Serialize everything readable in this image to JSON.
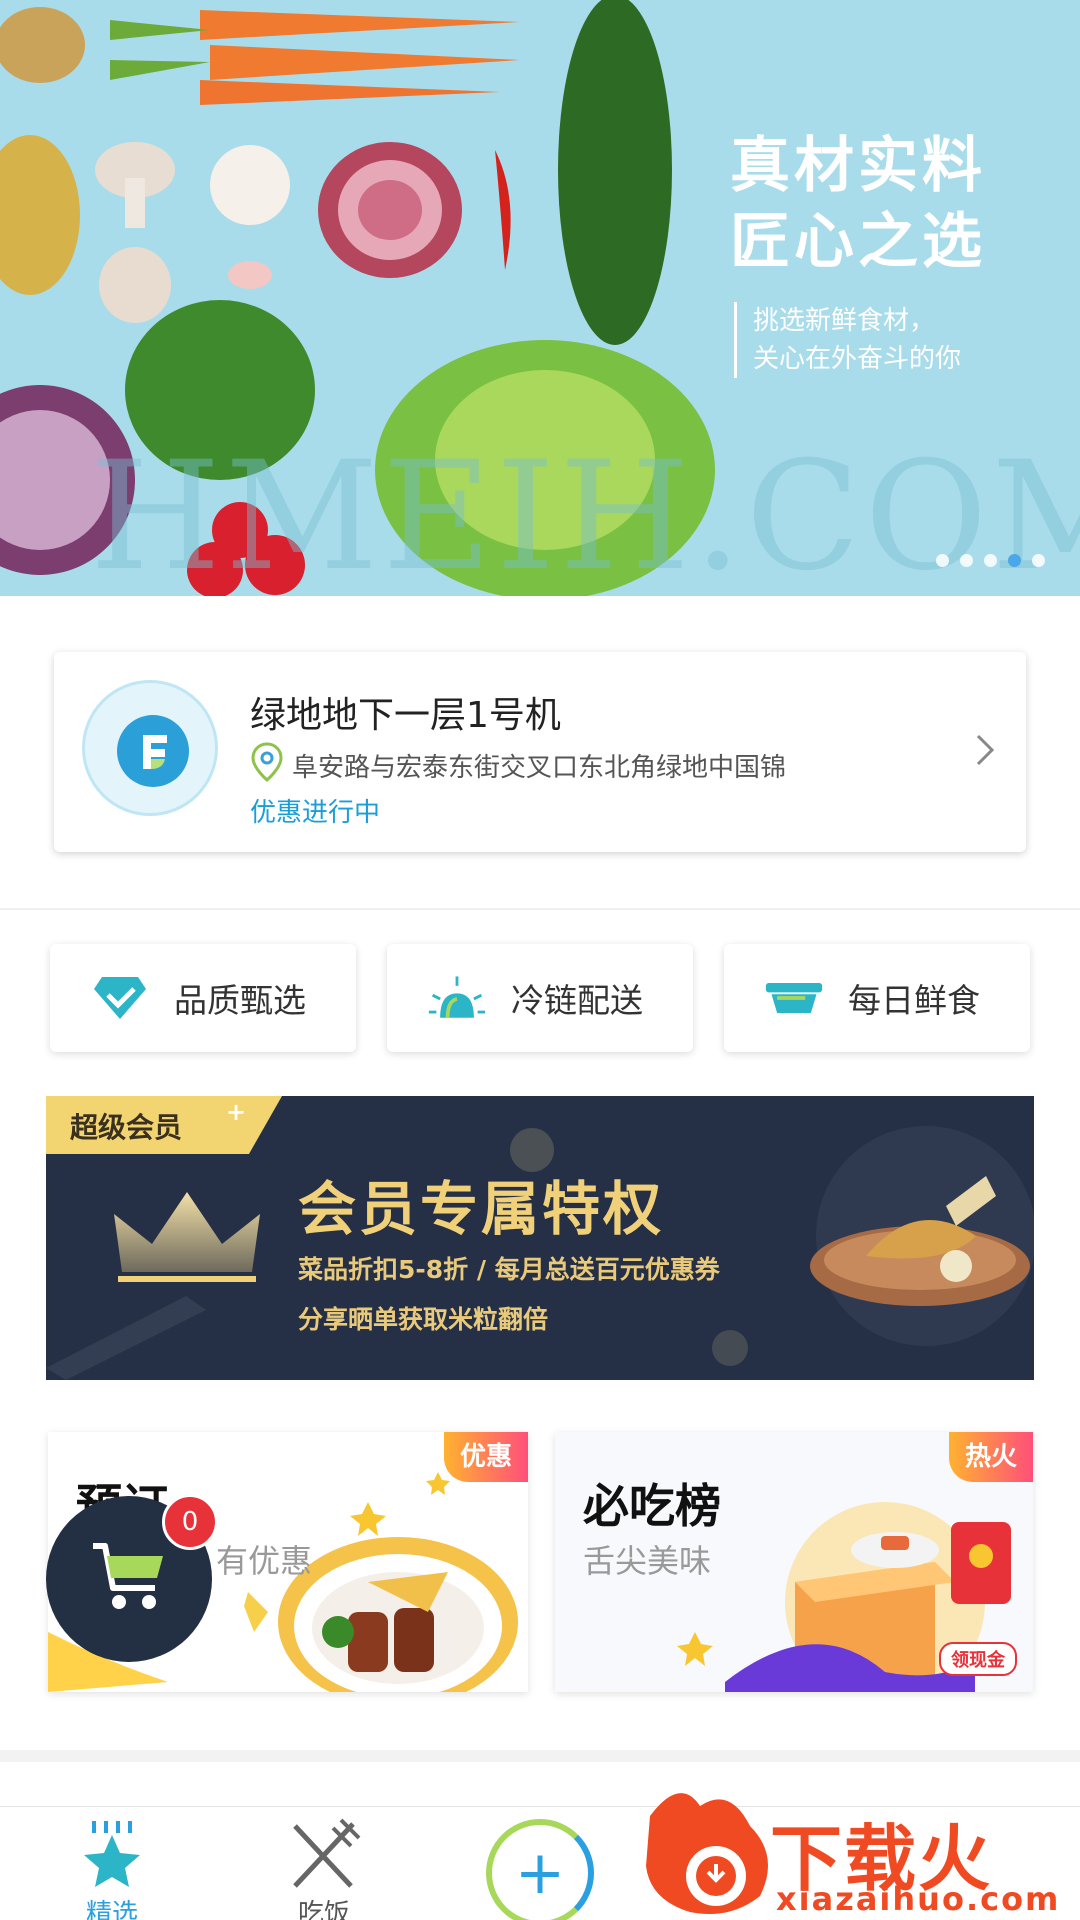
{
  "hero": {
    "headline_1": "真材实料",
    "headline_2": "匠心之选",
    "sub_1": "挑选新鲜食材，",
    "sub_2": "关心在外奋斗的你",
    "watermark": "HMEIH.COM",
    "slide_count": 5,
    "active_slide": 4
  },
  "machine": {
    "name": "绿地地下一层1号机",
    "address": "阜安路与宏泰东街交叉口东北角绿地中国锦",
    "promo": "优惠进行中"
  },
  "features": [
    {
      "label": "品质甄选",
      "icon": "diamond-icon"
    },
    {
      "label": "冷链配送",
      "icon": "light-icon"
    },
    {
      "label": "每日鲜食",
      "icon": "bowl-icon"
    }
  ],
  "vip": {
    "tag": "超级会员",
    "tag_plus": "+",
    "title": "会员专属特权",
    "line1": "菜品折扣5-8折 / 每月总送百元优惠券",
    "line2": "分享晒单获取米粒翻倍"
  },
  "promos": [
    {
      "badge": "优惠",
      "title": "预订",
      "subtitle": "有优惠"
    },
    {
      "badge": "热火",
      "title": "必吃榜",
      "subtitle": "舌尖美味",
      "hongbao": "领现金"
    }
  ],
  "cart": {
    "count": "0"
  },
  "tabbar": {
    "items": [
      {
        "label": "精选",
        "active": true
      },
      {
        "label": "吃饭",
        "active": false
      }
    ],
    "add_symbol": "+"
  },
  "download_watermark": {
    "text": "下载火",
    "url": "xiazaihuo.com"
  },
  "colors": {
    "accent": "#1a9ed8",
    "vip_bg": "#253046",
    "vip_gold": "#f1d07a",
    "badge_red": "#e8323a"
  }
}
